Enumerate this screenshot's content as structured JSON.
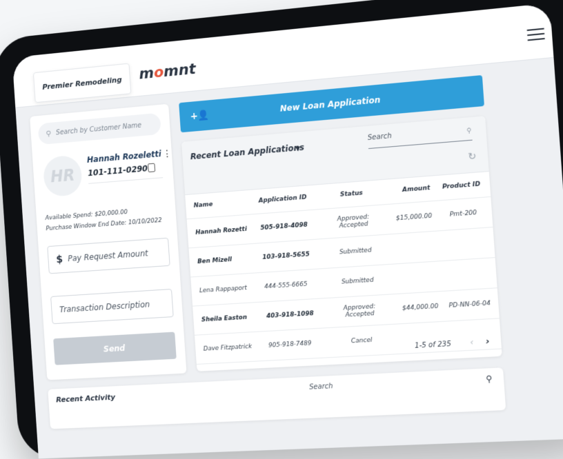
{
  "header": {
    "merchant": "Premier Remodeling",
    "brand_pre": "m",
    "brand_dot": "o",
    "brand_post": "mnt"
  },
  "left": {
    "search_placeholder": "Search by Customer Name",
    "avatar_initials": "HR",
    "customer_name": "Hannah Rozeletti",
    "customer_phone": "101-111-0290",
    "available_spend": "Available Spend: $20,000.00",
    "purchase_window": "Purchase Window End Date: 10/10/2022",
    "dollar_sign": "$",
    "pay_amount_placeholder": "Pay Request Amount",
    "description_placeholder": "Transaction Description",
    "send_label": "Send"
  },
  "loans": {
    "new_label": "New Loan Application",
    "title": "Recent Loan Applications",
    "search": "Search",
    "columns": {
      "name": "Name",
      "id": "Application ID",
      "status": "Status",
      "amount": "Amount",
      "product": "Product ID"
    },
    "rows": [
      {
        "name": "Hannah Rozetti",
        "id": "505-918-4098",
        "status": "Approved: Accepted",
        "amount": "$15,000.00",
        "product": "Pmt-200"
      },
      {
        "name": "Ben Mizell",
        "id": "103-918-5655",
        "status": "Submitted",
        "amount": "",
        "product": ""
      },
      {
        "name": "Lena Rappaport",
        "id": "444-555-6665",
        "status": "Submitted",
        "amount": "",
        "product": ""
      },
      {
        "name": "Sheila Easton",
        "id": "403-918-1098",
        "status": "Approved: Accepted",
        "amount": "$44,000.00",
        "product": "PD-NN-06-04"
      },
      {
        "name": "Dave Fitzpatrick",
        "id": "905-918-7489",
        "status": "Cancel",
        "amount": "",
        "product": ""
      }
    ],
    "pagination": "1-5 of 235"
  },
  "activity": {
    "title": "Recent Activity",
    "search": "Search"
  }
}
